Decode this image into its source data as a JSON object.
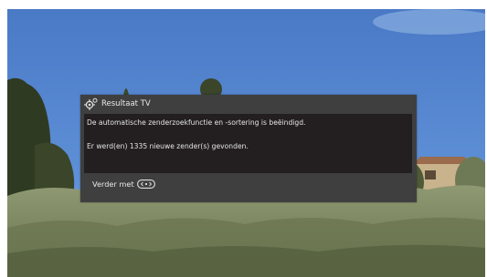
{
  "dialog": {
    "title": "Resultaat TV",
    "title_icon": "gear-icon",
    "message_line1": "De automatische zenderzoekfunctie en -sortering is beëindigd.",
    "message_line2": "Er werd(en) 1335 nieuwe zender(s) gevonden.",
    "footer_label": "Verder met",
    "footer_icon": "ok-button-icon"
  },
  "colors": {
    "dialog_background": "#3f3f3f",
    "body_background": "#231f20",
    "text": "#e4e4e4",
    "sky": "#3f72c2"
  }
}
